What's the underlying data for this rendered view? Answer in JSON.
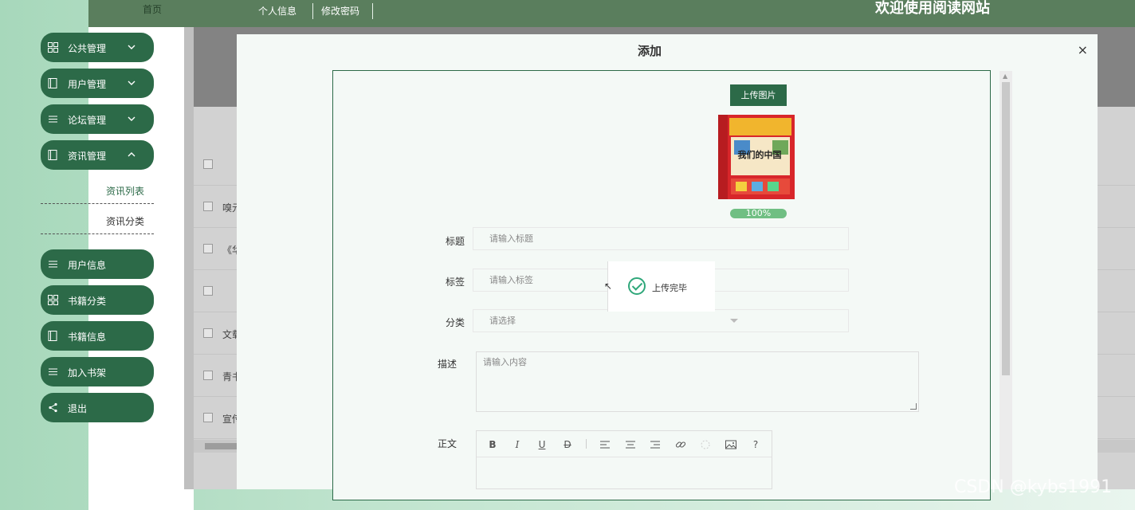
{
  "topbar": {
    "home": "首页",
    "nav": [
      "个人信息",
      "修改密码"
    ],
    "welcome": "欢迎使用阅读网站"
  },
  "sidebar": {
    "items": [
      {
        "label": "公共管理",
        "icon": "grid-icon",
        "chevron": "down"
      },
      {
        "label": "用户管理",
        "icon": "book-icon",
        "chevron": "down"
      },
      {
        "label": "论坛管理",
        "icon": "list-icon",
        "chevron": "down"
      },
      {
        "label": "资讯管理",
        "icon": "book-icon",
        "chevron": "up"
      }
    ],
    "subitems": [
      "资讯列表",
      "资讯分类"
    ],
    "items2": [
      {
        "label": "用户信息",
        "icon": "list-icon"
      },
      {
        "label": "书籍分类",
        "icon": "grid-icon"
      },
      {
        "label": "书籍信息",
        "icon": "book-icon"
      },
      {
        "label": "加入书架",
        "icon": "list-icon"
      },
      {
        "label": "退出",
        "icon": "share-icon"
      }
    ]
  },
  "background_table": {
    "row_snippets": [
      "",
      "嗅元",
      "《华",
      "",
      "文载",
      "青书",
      "宣传"
    ]
  },
  "modal": {
    "title": "添加",
    "close": "×",
    "upload_button": "上传图片",
    "progress": "100%",
    "progress_value": 100,
    "cover_text": "我们的中国",
    "fields": {
      "title_label": "标题",
      "title_placeholder": "请输入标题",
      "tag_label": "标签",
      "tag_placeholder": "请输入标签",
      "category_label": "分类",
      "category_placeholder": "请选择",
      "desc_label": "描述",
      "desc_placeholder": "请输入内容",
      "body_label": "正文"
    },
    "editor_tools": [
      "B",
      "I",
      "U",
      "D",
      "align-left-icon",
      "align-center-icon",
      "align-right-icon",
      "link-icon",
      "unlink-icon",
      "image-icon",
      "?"
    ],
    "toast": "上传完毕"
  },
  "watermark": "CSDN @kybs1991",
  "colors": {
    "primary": "#2c6a48",
    "topbar": "#5a7e5d",
    "progress": "#70bf83",
    "success": "#2fa77a"
  }
}
